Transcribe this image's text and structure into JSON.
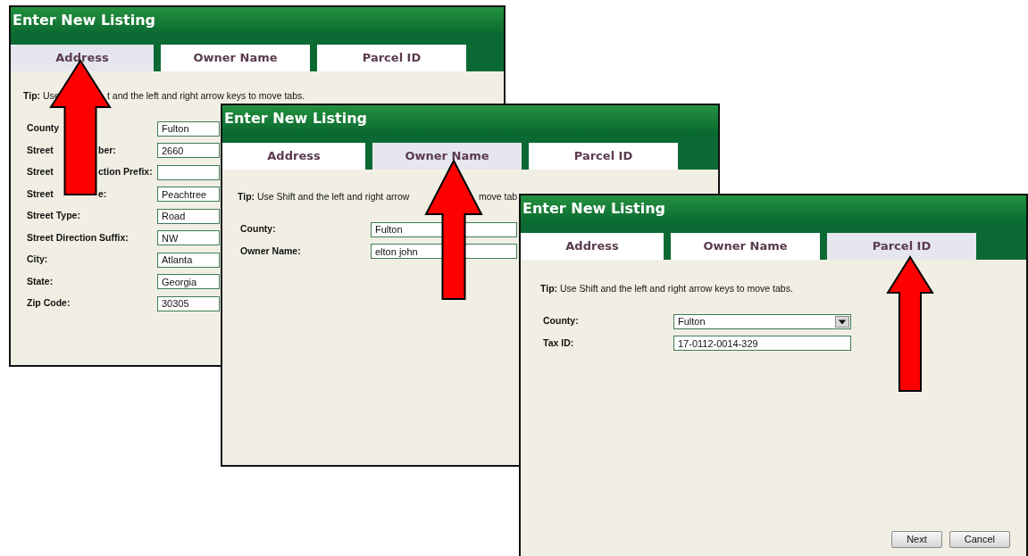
{
  "windows": [
    {
      "title": "Enter New Listing",
      "tabs": [
        {
          "label": "Address",
          "selected": true
        },
        {
          "label": "Owner Name",
          "selected": false
        },
        {
          "label": "Parcel ID",
          "selected": false
        }
      ],
      "tip": [
        "**Tip:** Use",
        "t and the left and right arrow keys to move tabs."
      ],
      "fields": [
        {
          "label": [
            "County"
          ],
          "value": "Fulton",
          "kind": "text"
        },
        {
          "label": [
            "Street",
            "ber:"
          ],
          "value": "2660",
          "kind": "text"
        },
        {
          "label": [
            "Street",
            "ction Prefix:"
          ],
          "kind": "text"
        },
        {
          "label": [
            "Street",
            "e:"
          ],
          "value": "Peachtree",
          "kind": "text"
        },
        {
          "label": [
            "Street Type:"
          ],
          "value": "Road",
          "kind": "text"
        },
        {
          "label": [
            "Street Direction Suffix:"
          ],
          "value": "NW",
          "kind": "text"
        },
        {
          "label": [
            "City:"
          ],
          "value": "Atlanta",
          "kind": "text"
        },
        {
          "label": [
            "State:"
          ],
          "value": "Georgia",
          "kind": "text"
        },
        {
          "label": [
            "Zip Code:"
          ],
          "value": "30305",
          "kind": "text"
        }
      ]
    },
    {
      "title": "Enter New Listing",
      "tabs": [
        {
          "label": "Address",
          "selected": false
        },
        {
          "label": "Owner Name",
          "selected": true
        },
        {
          "label": "Parcel ID",
          "selected": false
        }
      ],
      "tip": [
        "**Tip:** Use Shift and the left and right arrow",
        "move tab"
      ],
      "fields": [
        {
          "label": [
            "County:"
          ],
          "value": "Fulton",
          "kind": "text"
        },
        {
          "label": [
            "Owner Name:"
          ],
          "value": "elton john",
          "kind": "text"
        }
      ]
    },
    {
      "title": "Enter New Listing",
      "tabs": [
        {
          "label": "Address",
          "selected": false
        },
        {
          "label": "Owner Name",
          "selected": false
        },
        {
          "label": "Parcel ID",
          "selected": true
        }
      ],
      "tip": [
        "**Tip:** Use Shift and the left and right arrow keys to move tabs."
      ],
      "fields": [
        {
          "label": [
            "County:"
          ],
          "value": "Fulton",
          "kind": "dropdown"
        },
        {
          "label": [
            "Tax ID:"
          ],
          "value": "17-0112-0014-329",
          "kind": "text"
        }
      ],
      "buttons": [
        "Next",
        "Cancel"
      ]
    }
  ]
}
